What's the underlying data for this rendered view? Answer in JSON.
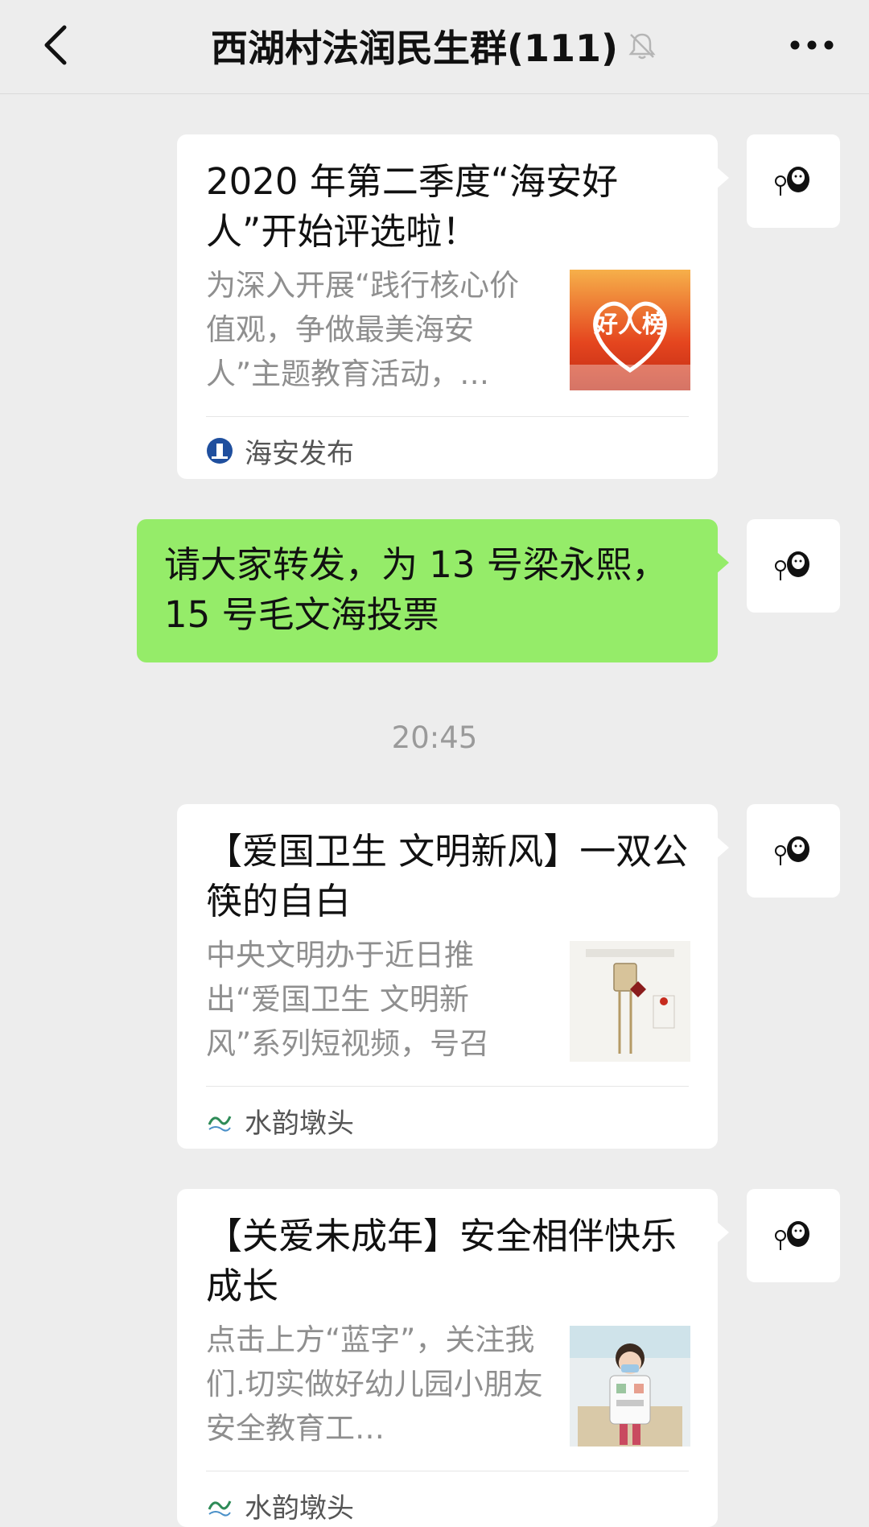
{
  "header": {
    "title": "西湖村法润民生群(111)"
  },
  "messages": [
    {
      "type": "article",
      "title": "2020 年第二季度“海安好人”开始评选啦！",
      "description": "为深入开展“践行核心价值观，争做最美海安人”主题教育活动，…",
      "thumb_caption": "好人榜",
      "source": "海安发布"
    },
    {
      "type": "text",
      "text": "请大家转发，为 13 号梁永熙，15 号毛文海投票"
    },
    {
      "type": "timestamp",
      "text": "20:45"
    },
    {
      "type": "article",
      "title": "【爱国卫生 文明新风】一双公筷的自白",
      "description": "中央文明办于近日推出“爱国卫生 文明新风”系列短视频，号召广…",
      "source": "水韵墩头"
    },
    {
      "type": "article",
      "title": "【关爱未成年】安全相伴快乐成长",
      "description": "点击上方“蓝字”，关注我们.切实做好幼儿园小朋友安全教育工…",
      "source": "水韵墩头"
    }
  ],
  "colors": {
    "background": "#ededed",
    "sent_bubble": "#95ec69",
    "card": "#ffffff"
  },
  "icons": {
    "back": "chevron-left-icon",
    "mute": "bell-off-icon",
    "more": "more-horizontal-icon",
    "avatar": "cartoon-avatar-icon"
  }
}
